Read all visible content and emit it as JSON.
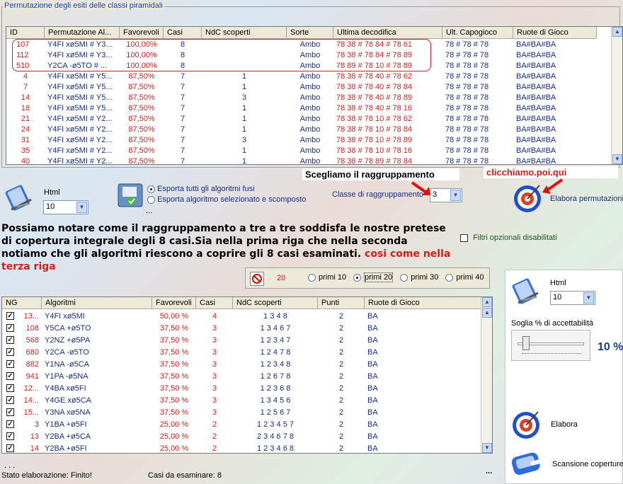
{
  "top_panel": {
    "title": "Permutazione degli esiti delle classi piramidali",
    "columns": [
      "ID",
      "Permutazione Al...",
      "Favorevoli",
      "Casi",
      "NdC scoperti",
      "Sorte",
      "Ultima decodifica",
      "Ult. Capogioco",
      "Ruote di Gioco"
    ],
    "rows": [
      [
        "107",
        "Y4FI xø5MI # Y3...",
        "100,00%",
        "8",
        "",
        "Ambo",
        "78 38 # 78 84 # 78 61",
        "78 # 78 # 78",
        "BA#BA#BA"
      ],
      [
        "112",
        "Y4FI xø5MI # Y3...",
        "100,00%",
        "8",
        "",
        "Ambo",
        "78 38 # 78 84 # 78 89",
        "78 # 78 # 78",
        "BA#BA#BA"
      ],
      [
        "510",
        "Y2CA -ø5TO # ...",
        "100,00%",
        "8",
        "",
        "Ambo",
        "78 89 # 78 10 # 78 89",
        "78 # 78 # 78",
        "BA#BA#BA"
      ],
      [
        "4",
        "Y4FI xø5MI # Y5...",
        "87,50%",
        "7",
        "1",
        "Ambo",
        "78 38 # 78 40 # 78 62",
        "78 # 78 # 78",
        "BA#BA#BA"
      ],
      [
        "7",
        "Y4FI xø5MI # Y5...",
        "87,50%",
        "7",
        "1",
        "Ambo",
        "78 38 # 78 40 # 78 84",
        "78 # 78 # 78",
        "BA#BA#BA"
      ],
      [
        "14",
        "Y4FI xø5MI # Y5...",
        "87,50%",
        "7",
        "3",
        "Ambo",
        "78 38 # 78 40 # 78 89",
        "78 # 78 # 78",
        "BA#BA#BA"
      ],
      [
        "18",
        "Y4FI xø5MI # Y5...",
        "87,50%",
        "7",
        "1",
        "Ambo",
        "78 38 # 78 40 # 78 16",
        "78 # 78 # 78",
        "BA#BA#BA"
      ],
      [
        "21",
        "Y4FI xø5MI # Y2...",
        "87,50%",
        "7",
        "1",
        "Ambo",
        "78 38 # 78 10 # 78 62",
        "78 # 78 # 78",
        "BA#BA#BA"
      ],
      [
        "24",
        "Y4FI xø5MI # Y2...",
        "87,50%",
        "7",
        "1",
        "Ambo",
        "78 38 # 78 10 # 78 84",
        "78 # 78 # 78",
        "BA#BA#BA"
      ],
      [
        "31",
        "Y4FI xø5MI # Y2...",
        "87,50%",
        "7",
        "3",
        "Ambo",
        "78 38 # 78 10 # 78 89",
        "78 # 78 # 78",
        "BA#BA#BA"
      ],
      [
        "35",
        "Y4FI xø5MI # Y2...",
        "87,50%",
        "7",
        "1",
        "Ambo",
        "78 38 # 78 10 # 78 16",
        "78 # 78 # 78",
        "BA#BA#BA"
      ],
      [
        "40",
        "Y4FI xø5MI # Y2...",
        "87,50%",
        "7",
        "1",
        "Ambo",
        "78 38 # 78 89 # 78 84",
        "78 # 78 # 78",
        "BA#BA#BA"
      ]
    ]
  },
  "controls": {
    "html_label": "Html",
    "html_value": "10",
    "export_all": "Esporta tutti gli algoritmi fusi",
    "export_selected": "Esporta algoritmo selezionato e scomposto",
    "ellipsis": "...",
    "callout_group": "Scegliamo il raggruppamento",
    "callout_click": "clicchiamo.poi.qui",
    "class_label": "Classe di raggruppamento",
    "class_value": "3",
    "process_perm": "Elabora permutazioni",
    "filters_label": "Filtri opzionali disabilitati"
  },
  "narrative": {
    "text": "Possiamo notare come il raggruppamento a tre a tre soddisfa le nostre pretese di copertura integrale degli 8 casi.Sia nella prima riga che nella seconda notiamo che gli algoritmi riescono a coprire gli 8 casi esaminati.",
    "red_text": "cosi come nella terza riga"
  },
  "filter_bar": {
    "value": "20",
    "options": [
      "primi 10",
      "primi 20",
      "primi 30",
      "primi 40"
    ],
    "selected": "primi 20"
  },
  "bottom_table": {
    "columns": [
      "NG",
      "Algoritmi",
      "Favorevoli",
      "Casi",
      "NdC scoperti",
      "Punti",
      "Ruote di Gioco"
    ],
    "rows": [
      [
        "13...",
        "Y4FI xø5MI",
        "50,00 %",
        "4",
        "1 3 4 8",
        "2",
        "BA"
      ],
      [
        "108",
        "Y5CA +ø5TO",
        "37,50 %",
        "3",
        "1 3 4 6 7",
        "2",
        "BA"
      ],
      [
        "568",
        "Y2NZ +ø5PA",
        "37,50 %",
        "3",
        "1 2 3 4 7",
        "2",
        "BA"
      ],
      [
        "680",
        "Y2CA -ø5TO",
        "37,50 %",
        "3",
        "1 2 4 7 8",
        "2",
        "BA"
      ],
      [
        "882",
        "Y1NA -ø5CA",
        "37,50 %",
        "3",
        "1 2 3 4 8",
        "2",
        "BA"
      ],
      [
        "941",
        "Y1PA -ø5NA",
        "37,50 %",
        "3",
        "1 2 6 7 8",
        "2",
        "BA"
      ],
      [
        "12...",
        "Y4BA xø5FI",
        "37,50 %",
        "3",
        "1 2 3 6 8",
        "2",
        "BA"
      ],
      [
        "14...",
        "Y4GE xø5CA",
        "37,50 %",
        "3",
        "1 3 4 5 6",
        "2",
        "BA"
      ],
      [
        "15...",
        "Y3NA xø5NA",
        "37,50 %",
        "3",
        "1 2 5 6 7",
        "2",
        "BA"
      ],
      [
        "3",
        "Y1BA +ø5FI",
        "25,00 %",
        "2",
        "1 2 3 4 5 7",
        "2",
        "BA"
      ],
      [
        "13",
        "Y2BA +ø5CA",
        "25,00 %",
        "2",
        "2 3 4 6 7 8",
        "2",
        "BA"
      ],
      [
        "14",
        "Y2BA +ø5FI",
        "25,00 %",
        "2",
        "1 2 3 4 6 8",
        "2",
        "BA"
      ]
    ]
  },
  "right_panel": {
    "html_label": "Html",
    "html_value": "10",
    "threshold_label": "Soglia % di accettabilità",
    "threshold_value": "10 %",
    "process": "Elabora",
    "scan": "Scansione coperture"
  },
  "status": {
    "dots": ". . .",
    "state": "Stato elaborazione: Finito!",
    "cases": "Casi da esaminare: 8",
    "more": "..."
  }
}
